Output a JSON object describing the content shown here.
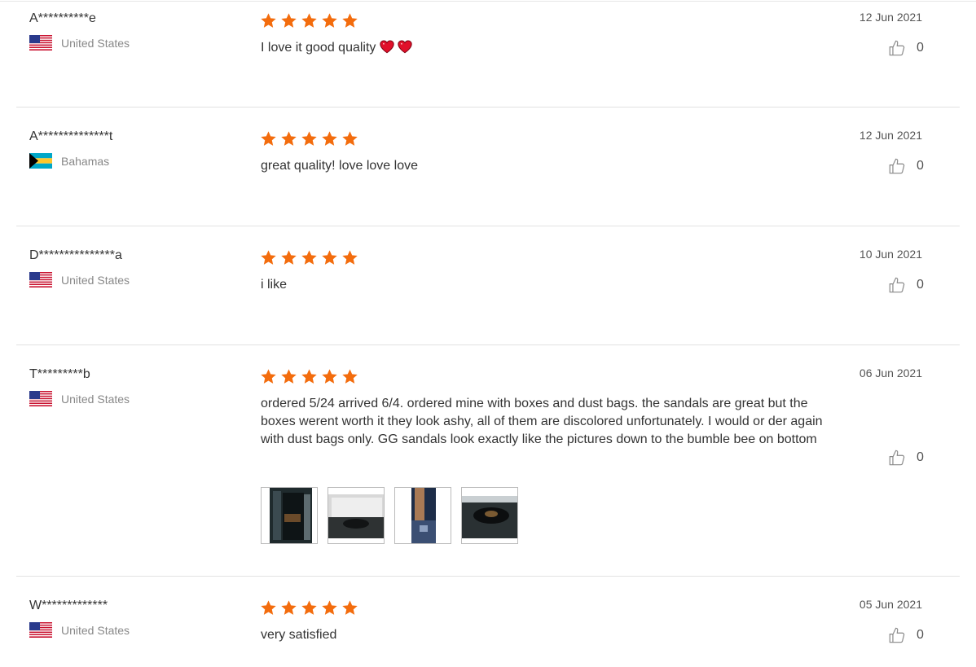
{
  "reviews": [
    {
      "user": "A**********e",
      "country": "United States",
      "flag": "us-flag",
      "stars": 5,
      "text": "I love it good quality",
      "date": "12 Jun 2021",
      "likes": "0"
    },
    {
      "user": "A**************t",
      "country": "Bahamas",
      "flag": "bahamas-flag",
      "stars": 5,
      "text": "great quality! love love love",
      "date": "12 Jun 2021",
      "likes": "0"
    },
    {
      "user": "D***************a",
      "country": "United States",
      "flag": "us-flag",
      "stars": 5,
      "text": "i like",
      "date": "10 Jun 2021",
      "likes": "0"
    },
    {
      "user": "T*********b",
      "country": "United States",
      "flag": "us-flag",
      "stars": 5,
      "text": "ordered 5/24 arrived 6/4. ordered mine with boxes and dust bags. the sandals are great but the boxes werent worth it they look ashy, all of them are discolored unfortunately. I would or der again with dust bags only. GG sandals look exactly like the pictures down to the bumble bee on bottom",
      "date": "06 Jun 2021",
      "likes": "0",
      "photo_count": 4
    },
    {
      "user": "W*************",
      "country": "United States",
      "flag": "us-flag",
      "stars": 5,
      "text": "very satisfied",
      "date": "05 Jun 2021",
      "likes": "0"
    }
  ],
  "colors": {
    "star": "#f36c0d",
    "heart": "#e0102a",
    "separator": "#e2e2e2"
  }
}
